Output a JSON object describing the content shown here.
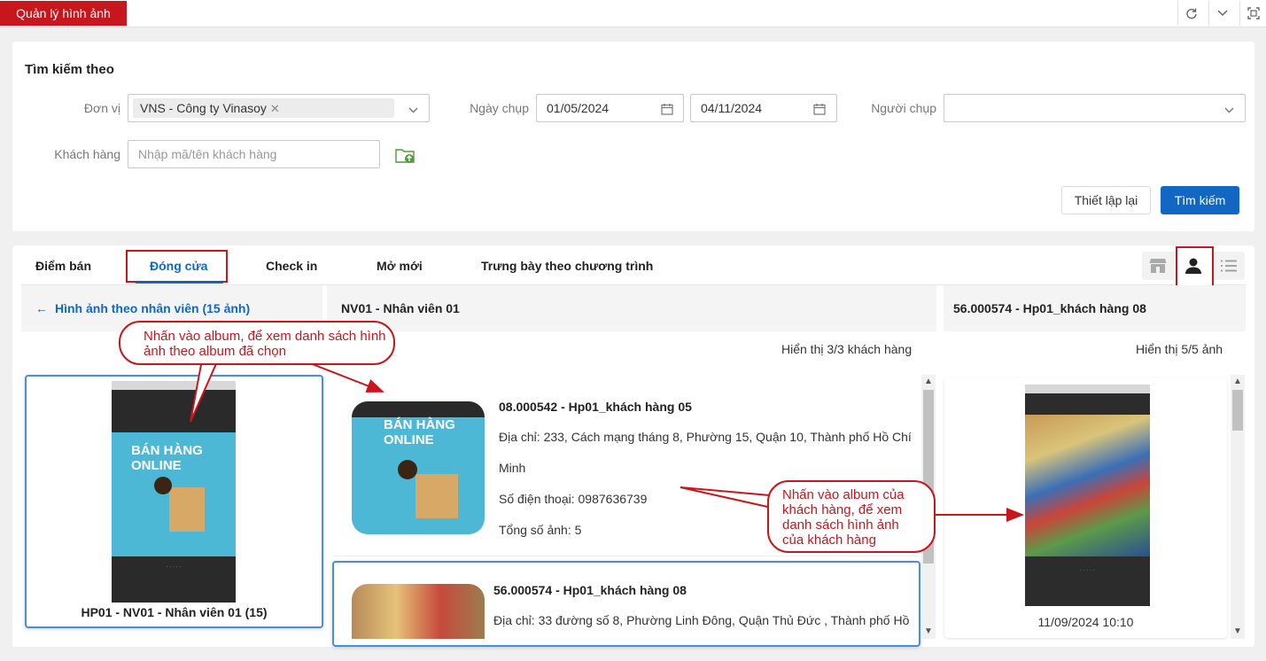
{
  "app": {
    "title": "Quản lý hình ảnh"
  },
  "search": {
    "title": "Tìm kiếm theo",
    "unit_label": "Đơn vị",
    "unit_value": "VNS - Công ty Vinasoy",
    "date_label": "Ngày chụp",
    "date_from": "01/05/2024",
    "date_to": "04/11/2024",
    "photographer_label": "Người chụp",
    "customer_label": "Khách hàng",
    "customer_placeholder": "Nhập mã/tên khách hàng",
    "reset_label": "Thiết lập lại",
    "search_label": "Tìm kiếm"
  },
  "tabs": [
    "Điểm bán",
    "Đóng cửa",
    "Check in",
    "Mở mới",
    "Trưng bày theo chương trình"
  ],
  "left_column": {
    "back_label": "Hình ảnh theo nhân viên (15 ảnh)",
    "album_caption": "HP01 - NV01 - Nhân viên 01 (15)",
    "thumb_text": "BÁN HÀNG ONLINE"
  },
  "middle_column": {
    "header": "NV01 - Nhân viên 01",
    "count_text": "Hiển thị 3/3 khách hàng",
    "customers": [
      {
        "title": "08.000542 - Hp01_khách hàng 05",
        "address": "Địa chỉ: 233, Cách mạng tháng 8, Phường 15, Quận 10, Thành phố Hồ Chí Minh",
        "phone": "Số điện thoại: 0987636739",
        "total": "Tổng số ảnh: 5",
        "thumb_text": "BÁN HÀNG ONLINE"
      },
      {
        "title": "56.000574 - Hp01_khách hàng 08",
        "address": "Địa chỉ: 33 đường số 8, Phường Linh Đông, Quận Thủ Đức , Thành phố Hồ"
      }
    ]
  },
  "right_column": {
    "header": "56.000574 - Hp01_khách hàng 08",
    "count_text": "Hiển thị 5/5 ảnh",
    "photo_time": "11/09/2024 10:10"
  },
  "callouts": {
    "album": "Nhấn vào album, để xem danh sách hình ảnh theo album đã chọn",
    "customer": "Nhấn vào album của khách hàng, để xem danh sách hình ảnh của khách hàng"
  },
  "colors": {
    "brand_red": "#c8161d",
    "primary_blue": "#1266c4"
  }
}
